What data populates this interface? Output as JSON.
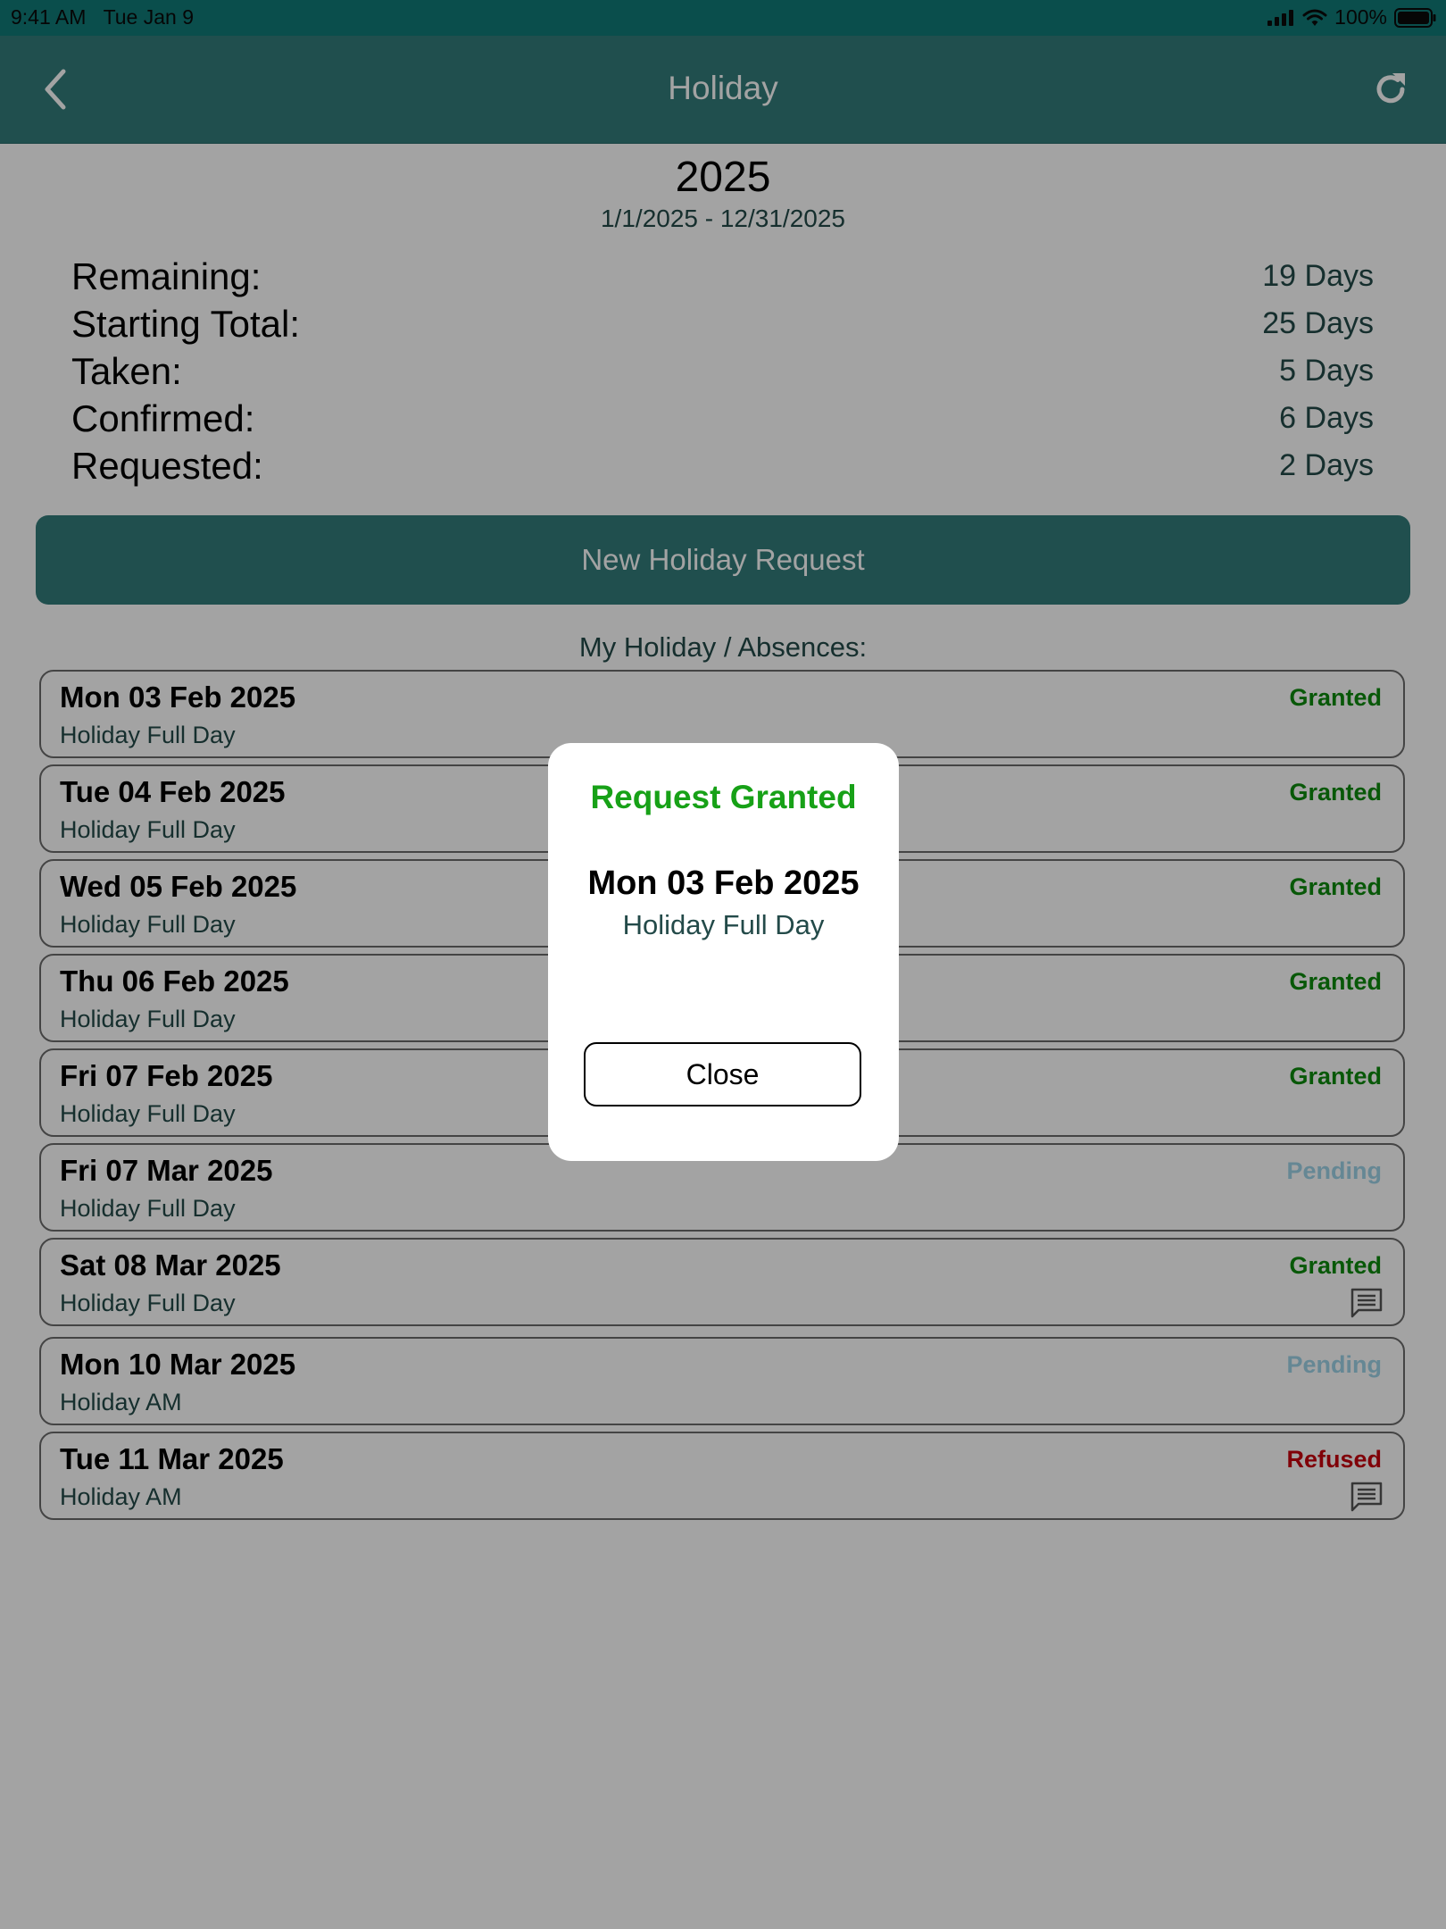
{
  "status_bar": {
    "time": "9:41 AM",
    "date": "Tue Jan 9",
    "battery": "100%"
  },
  "nav": {
    "title": "Holiday",
    "back_icon": "chevron-left-icon",
    "refresh_icon": "refresh-icon"
  },
  "summary": {
    "year": "2025",
    "range": "1/1/2025 - 12/31/2025",
    "stats": [
      {
        "label": "Remaining:",
        "value": "19 Days"
      },
      {
        "label": "Starting Total:",
        "value": "25 Days"
      },
      {
        "label": "Taken:",
        "value": "5 Days"
      },
      {
        "label": "Confirmed:",
        "value": "6 Days"
      },
      {
        "label": "Requested:",
        "value": "2 Days"
      }
    ]
  },
  "actions": {
    "new_request_label": "New Holiday Request"
  },
  "list": {
    "heading": "My Holiday / Absences:",
    "items": [
      {
        "date": "Mon 03 Feb 2025",
        "type": "Holiday Full Day",
        "status": "Granted",
        "status_color": "#0d8a0d",
        "has_comment": false
      },
      {
        "date": "Tue 04 Feb 2025",
        "type": "Holiday Full Day",
        "status": "Granted",
        "status_color": "#0d8a0d",
        "has_comment": false
      },
      {
        "date": "Wed 05 Feb 2025",
        "type": "Holiday Full Day",
        "status": "Granted",
        "status_color": "#0d8a0d",
        "has_comment": false
      },
      {
        "date": "Thu 06 Feb 2025",
        "type": "Holiday Full Day",
        "status": "Granted",
        "status_color": "#0d8a0d",
        "has_comment": false
      },
      {
        "date": "Fri 07 Feb 2025",
        "type": "Holiday Full Day",
        "status": "Granted",
        "status_color": "#0d8a0d",
        "has_comment": false
      },
      {
        "date": "Fri 07 Mar 2025",
        "type": "Holiday Full Day",
        "status": "Pending",
        "status_color": "#9ed3e8",
        "has_comment": false
      },
      {
        "date": "Sat 08 Mar 2025",
        "type": "Holiday Full Day",
        "status": "Granted",
        "status_color": "#0d8a0d",
        "has_comment": true
      },
      {
        "date": "Mon 10 Mar 2025",
        "type": "Holiday AM",
        "status": "Pending",
        "status_color": "#9ed3e8",
        "has_comment": false
      },
      {
        "date": "Tue 11 Mar 2025",
        "type": "Holiday AM",
        "status": "Refused",
        "status_color": "#c8000e",
        "has_comment": true
      }
    ]
  },
  "modal": {
    "title": "Request Granted",
    "date": "Mon 03 Feb 2025",
    "type": "Holiday Full Day",
    "close_label": "Close"
  },
  "colors": {
    "header": "#327c7b",
    "status_bar": "#117a78",
    "granted": "#0d8a0d",
    "pending": "#9ed3e8",
    "refused": "#c8000e",
    "modal_title": "#17a117"
  }
}
